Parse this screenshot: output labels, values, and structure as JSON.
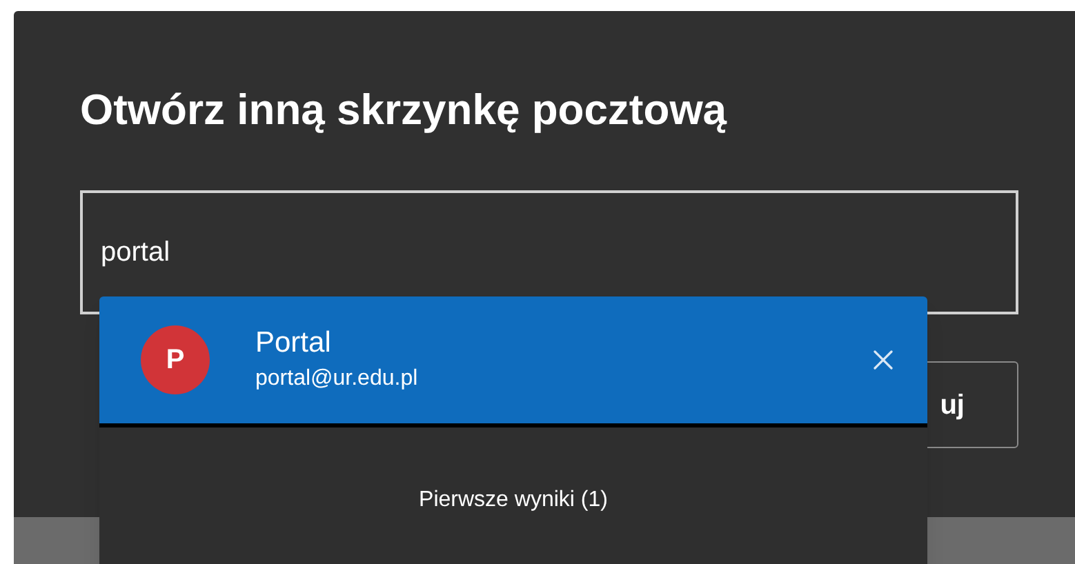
{
  "dialog": {
    "title": "Otwórz inną skrzynkę pocztową",
    "input": {
      "value": "portal"
    },
    "button": {
      "label": "uj"
    }
  },
  "suggestions": {
    "items": [
      {
        "initial": "P",
        "name": "Portal",
        "email": "portal@ur.edu.pl",
        "color": "#d13438",
        "selected": true
      }
    ],
    "footer": "Pierwsze wyniki (1)"
  }
}
